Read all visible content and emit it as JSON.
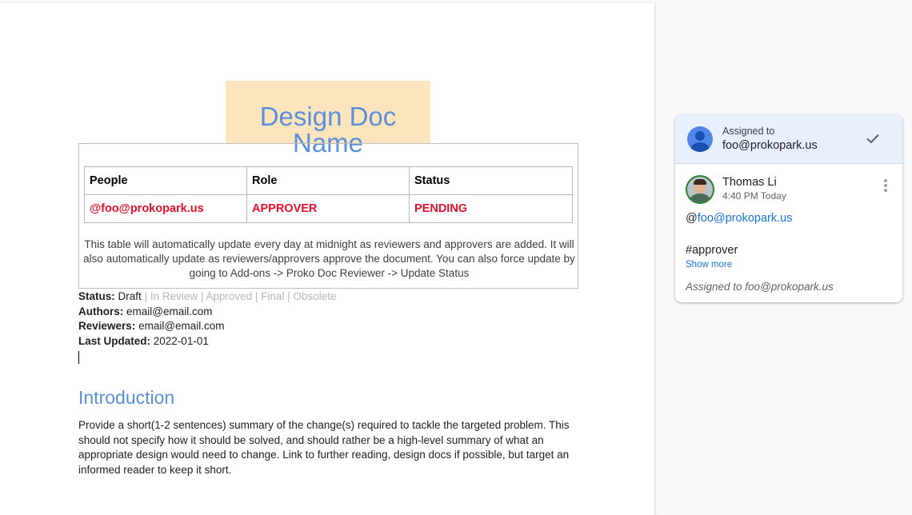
{
  "document": {
    "title": "Design Doc Name",
    "table": {
      "headers": [
        "People",
        "Role",
        "Status"
      ],
      "rows": [
        [
          "@foo@prokopark.us",
          "APPROVER",
          "PENDING"
        ]
      ],
      "note": "This table will automatically update every day at midnight as reviewers and approvers are added. It will also automatically update as reviewers/approvers approve the document. You can also force update by going to Add-ons -> Proko Doc Reviewer -> Update Status"
    },
    "meta": {
      "status_label": "Status:",
      "status_value": "Draft",
      "status_others": "| In Review | Approved | Final | Obsolete",
      "authors_label": "Authors:",
      "authors_value": "email@email.com",
      "reviewers_label": "Reviewers:",
      "reviewers_value": "email@email.com",
      "updated_label": "Last Updated:",
      "updated_value": "2022-01-01"
    },
    "intro": {
      "heading": "Introduction",
      "body": "Provide a short(1-2 sentences) summary of the change(s) required to tackle the targeted problem. This should not specify how it should be solved, and should rather be a high-level summary of what an appropriate design would need to change. Link to further reading, design docs if possible, but target an informed reader to keep it short."
    }
  },
  "comment": {
    "assigned_label": "Assigned to",
    "assigned_email": "foo@prokopark.us",
    "author": "Thomas Li",
    "time": "4:40 PM Today",
    "mention_at": "@",
    "mention_link": "foo@prokopark.us",
    "hashtag": "#approver",
    "show_more": "Show more",
    "footer": "Assigned to foo@prokopark.us",
    "icons": [
      "person-avatar-icon",
      "check-icon",
      "more-vert-icon"
    ]
  },
  "colors": {
    "accent_blue": "#5b8fd9",
    "title_highlight": "#fce5bd",
    "status_red": "#e8102b",
    "link_blue": "#1a73e8",
    "assign_header_bg": "#e8f0fe"
  }
}
